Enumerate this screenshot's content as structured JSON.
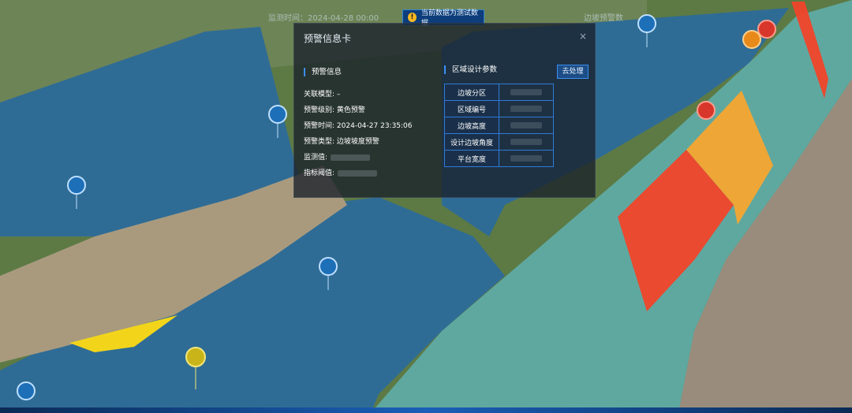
{
  "banner": {
    "left_text": "监测时间：2024-04-28 00:00",
    "center_text": "当前数据为测试数据",
    "right_text": "边坡预警数"
  },
  "card": {
    "title": "预警信息卡",
    "close_symbol": "×",
    "warning_section": "预警信息",
    "params_section": "区域设计参数",
    "handle_button": "去处理",
    "rows": [
      {
        "label": "关联模型:",
        "value": "–"
      },
      {
        "label": "预警级别:",
        "value": "黄色预警"
      },
      {
        "label": "预警时间:",
        "value": "2024-04-27 23:35:06"
      },
      {
        "label": "预警类型:",
        "value": "边坡坡度预警"
      },
      {
        "label": "监测值:",
        "value": ""
      },
      {
        "label": "指标阈值:",
        "value": ""
      }
    ],
    "params": [
      {
        "label": "边坡分区"
      },
      {
        "label": "区域编号"
      },
      {
        "label": "边坡高度"
      },
      {
        "label": "设计边坡角度"
      },
      {
        "label": "平台宽度"
      }
    ]
  },
  "colors": {
    "red_zone": "#f0452a",
    "orange_zone": "#f6a532",
    "yellow_zone": "#f2d51a",
    "water": "#2f6c95",
    "panel_accent": "#3b8ff0"
  }
}
